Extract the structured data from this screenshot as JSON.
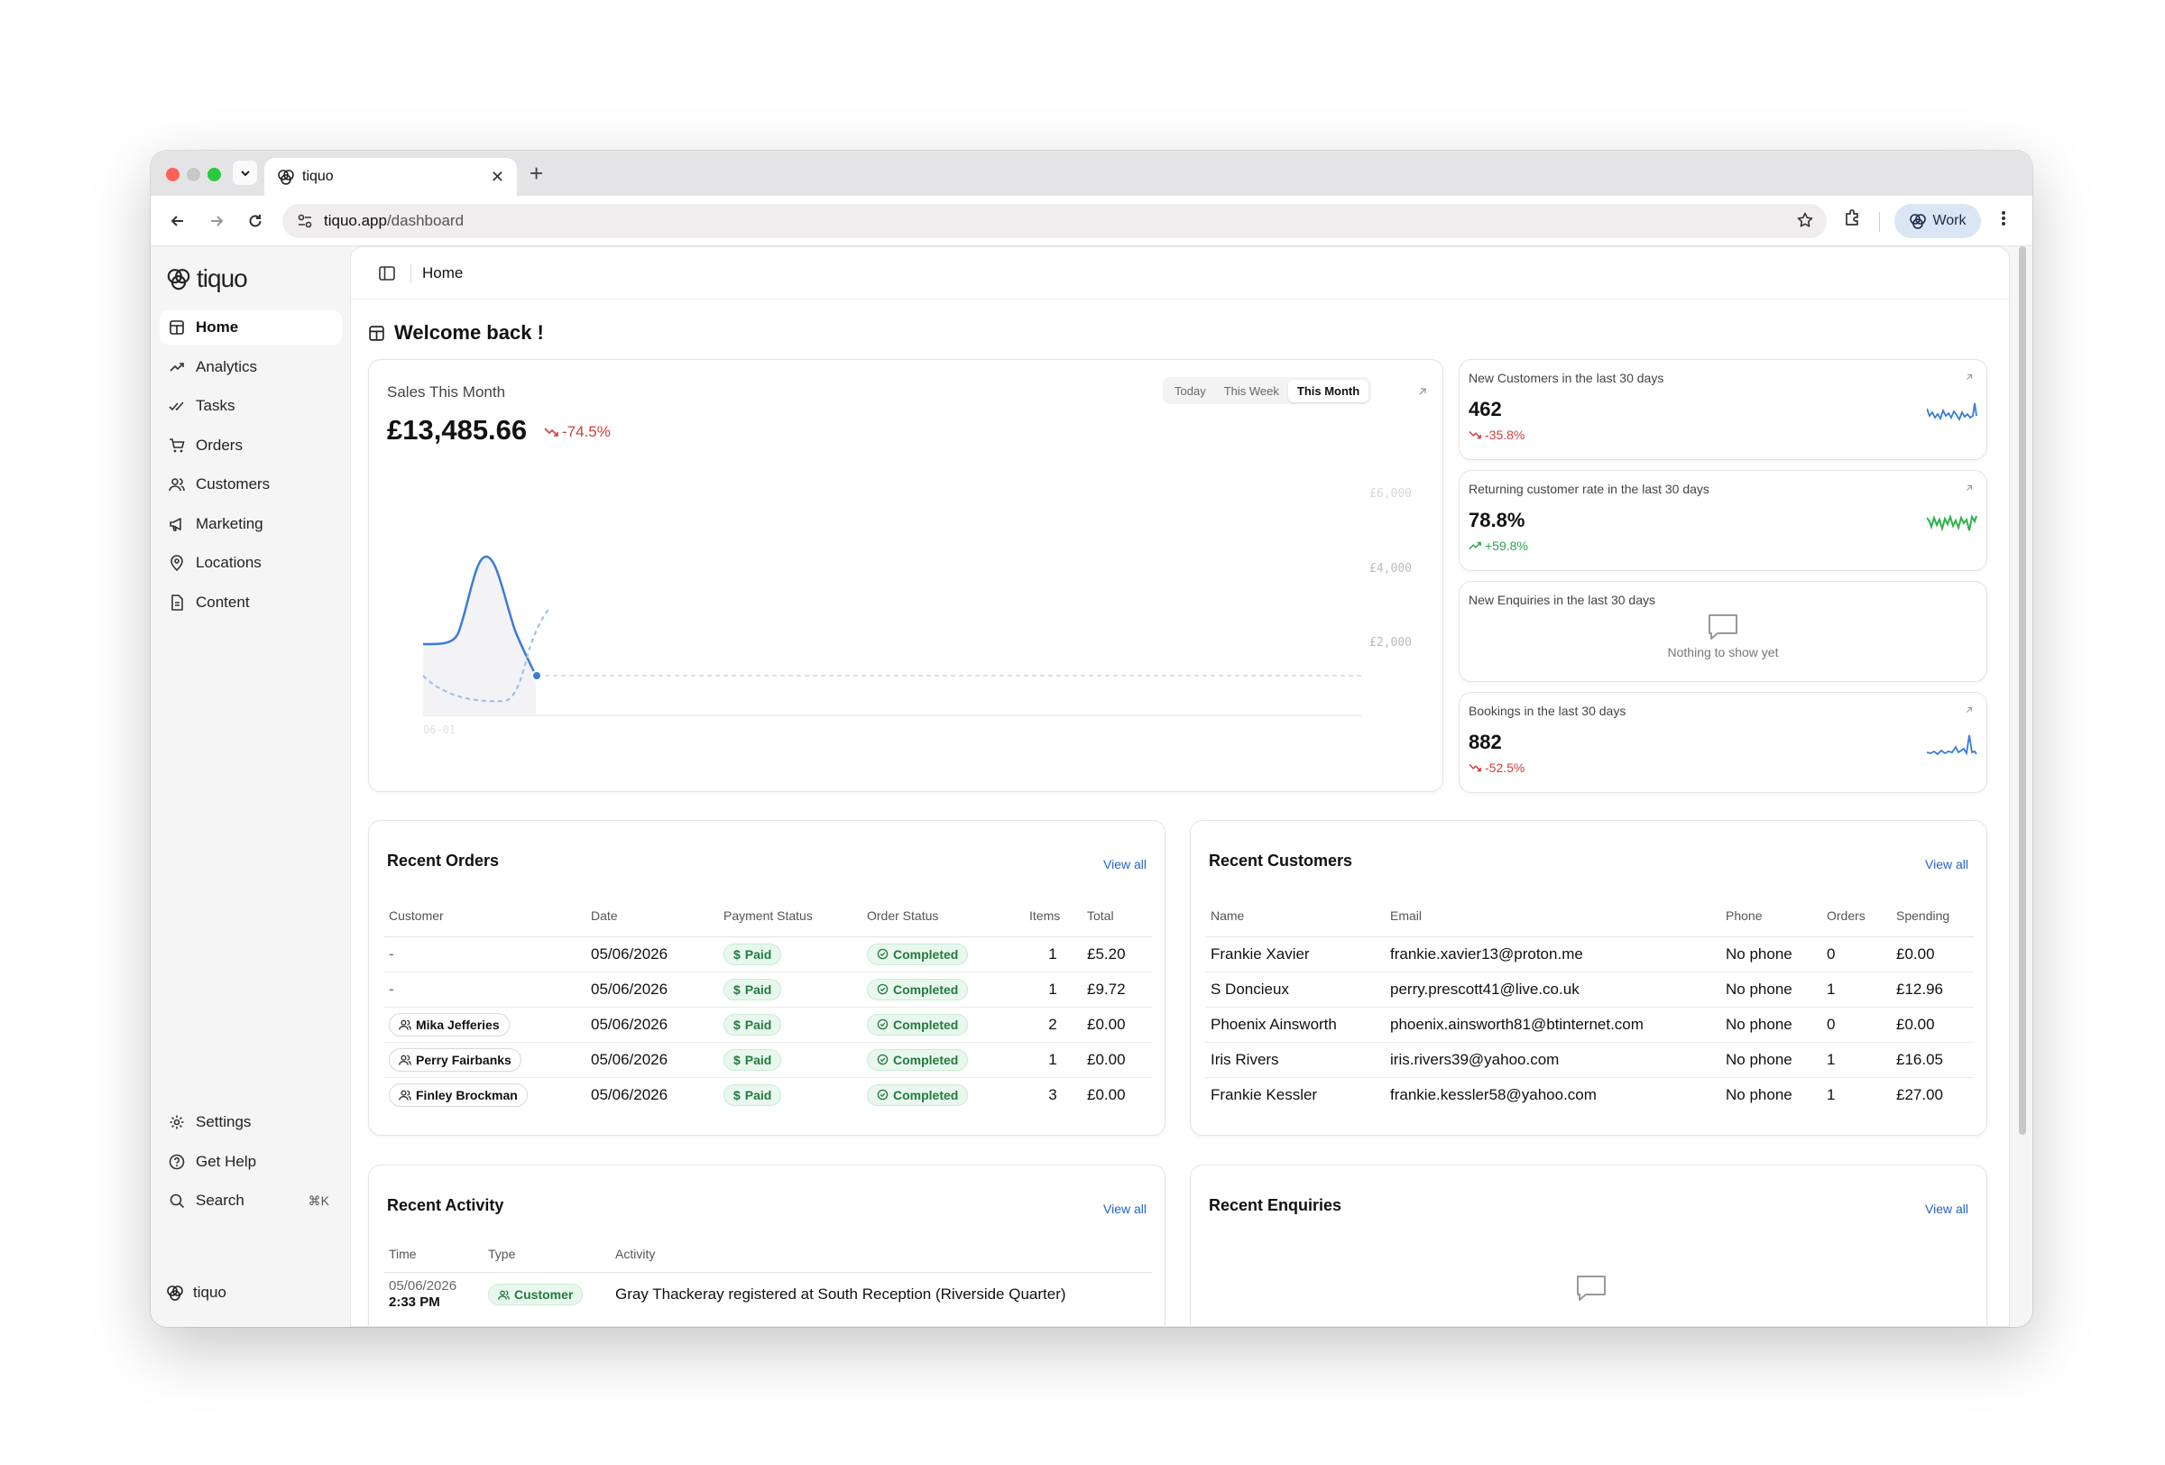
{
  "browser": {
    "tab_title": "tiquo",
    "url_host": "tiquo.app",
    "url_path": "/dashboard",
    "profile_label": "Work"
  },
  "sidebar": {
    "logo_text": "tiquo",
    "items": [
      {
        "label": "Home",
        "icon": "layout-icon",
        "active": true
      },
      {
        "label": "Analytics",
        "icon": "trending-up-icon"
      },
      {
        "label": "Tasks",
        "icon": "check-double-icon"
      },
      {
        "label": "Orders",
        "icon": "cart-icon"
      },
      {
        "label": "Customers",
        "icon": "users-icon"
      },
      {
        "label": "Marketing",
        "icon": "megaphone-icon"
      },
      {
        "label": "Locations",
        "icon": "map-pin-icon"
      },
      {
        "label": "Content",
        "icon": "file-icon"
      }
    ],
    "bottom": {
      "settings": "Settings",
      "help": "Get Help",
      "search": "Search",
      "search_shortcut": "⌘K"
    },
    "org_name": "tiquo"
  },
  "header": {
    "breadcrumb": "Home"
  },
  "welcome": "Welcome back !",
  "sales": {
    "title": "Sales This Month",
    "value": "£13,485.66",
    "delta": "-74.5%",
    "ranges": [
      "Today",
      "This Week",
      "This Month"
    ],
    "selected_range": "This Month",
    "y_ticks": [
      "£6,000",
      "£4,000",
      "£2,000"
    ],
    "x_tick": "06-01"
  },
  "metrics": [
    {
      "title": "New Customers in the last 30 days",
      "value": "462",
      "delta": "-35.8%",
      "trend": "down",
      "spark_color": "#3b7bd8"
    },
    {
      "title": "Returning customer rate in the last 30 days",
      "value": "78.8%",
      "delta": "+59.8%",
      "trend": "up",
      "spark_color": "#2bb34a"
    },
    {
      "title": "New Enquiries in the last 30 days",
      "empty_text": "Nothing to show yet"
    },
    {
      "title": "Bookings in the last 30 days",
      "value": "882",
      "delta": "-52.5%",
      "trend": "down",
      "spark_color": "#3b7bd8"
    }
  ],
  "recent_orders": {
    "title": "Recent Orders",
    "view_all": "View all",
    "columns": [
      "Customer",
      "Date",
      "Payment Status",
      "Order Status",
      "Items",
      "Total"
    ],
    "rows": [
      {
        "customer": "-",
        "date": "05/06/2026",
        "payment": "Paid",
        "status": "Completed",
        "items": "1",
        "total": "£5.20"
      },
      {
        "customer": "-",
        "date": "05/06/2026",
        "payment": "Paid",
        "status": "Completed",
        "items": "1",
        "total": "£9.72"
      },
      {
        "customer": "Mika Jefferies",
        "date": "05/06/2026",
        "payment": "Paid",
        "status": "Completed",
        "items": "2",
        "total": "£0.00"
      },
      {
        "customer": "Perry Fairbanks",
        "date": "05/06/2026",
        "payment": "Paid",
        "status": "Completed",
        "items": "1",
        "total": "£0.00"
      },
      {
        "customer": "Finley Brockman",
        "date": "05/06/2026",
        "payment": "Paid",
        "status": "Completed",
        "items": "3",
        "total": "£0.00"
      }
    ]
  },
  "recent_customers": {
    "title": "Recent Customers",
    "view_all": "View all",
    "columns": [
      "Name",
      "Email",
      "Phone",
      "Orders",
      "Spending"
    ],
    "rows": [
      {
        "name": "Frankie Xavier",
        "email": "frankie.xavier13@proton.me",
        "phone": "No phone",
        "orders": "0",
        "spending": "£0.00"
      },
      {
        "name": "S Doncieux",
        "email": "perry.prescott41@live.co.uk",
        "phone": "No phone",
        "orders": "1",
        "spending": "£12.96"
      },
      {
        "name": "Phoenix Ainsworth",
        "email": "phoenix.ainsworth81@btinternet.com",
        "phone": "No phone",
        "orders": "0",
        "spending": "£0.00"
      },
      {
        "name": "Iris Rivers",
        "email": "iris.rivers39@yahoo.com",
        "phone": "No phone",
        "orders": "1",
        "spending": "£16.05"
      },
      {
        "name": "Frankie Kessler",
        "email": "frankie.kessler58@yahoo.com",
        "phone": "No phone",
        "orders": "1",
        "spending": "£27.00"
      }
    ]
  },
  "recent_activity": {
    "title": "Recent Activity",
    "view_all": "View all",
    "columns": [
      "Time",
      "Type",
      "Activity"
    ],
    "rows": [
      {
        "date": "05/06/2026",
        "time": "2:33 PM",
        "type": "Customer",
        "activity": "Gray Thackeray registered at South Reception (Riverside Quarter)"
      }
    ]
  },
  "recent_enquiries": {
    "title": "Recent Enquiries",
    "view_all": "View all"
  },
  "colors": {
    "accent_blue": "#2563c9",
    "negative": "#d43b3b",
    "positive": "#2da44e",
    "paid_badge_bg": "#e9f8ee"
  }
}
